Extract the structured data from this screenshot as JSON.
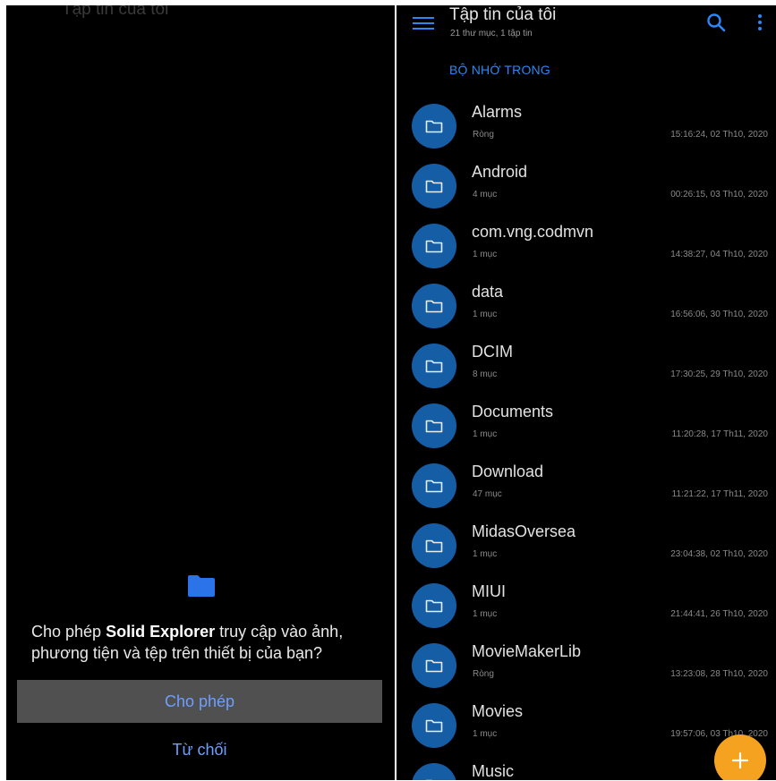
{
  "left_panel": {
    "faded_title": "Tập tin của tôi",
    "permission_prefix": "Cho phép ",
    "permission_app": "Solid Explorer",
    "permission_suffix": " truy cập vào ảnh, phương tiện và tệp trên thiết bị của bạn?",
    "allow_label": "Cho phép",
    "deny_label": "Từ chối",
    "icon": "folder-icon"
  },
  "right_panel": {
    "title": "Tập tin của tôi",
    "subtitle": "21 thư mục, 1 tập tin",
    "section": "BỘ NHỚ TRONG",
    "icons": [
      "menu-icon",
      "search-icon",
      "more-vert-icon",
      "folder-icon",
      "plus-icon"
    ],
    "files": [
      {
        "name": "Alarms",
        "meta": "Ròng",
        "date": "15:16:24, 02 Th10, 2020"
      },
      {
        "name": "Android",
        "meta": "4 mục",
        "date": "00:26:15, 03 Th10, 2020"
      },
      {
        "name": "com.vng.codmvn",
        "meta": "1 mục",
        "date": "14:38:27, 04 Th10, 2020"
      },
      {
        "name": "data",
        "meta": "1 mục",
        "date": "16:56:06, 30 Th10, 2020"
      },
      {
        "name": "DCIM",
        "meta": "8 mục",
        "date": "17:30:25, 29 Th10, 2020"
      },
      {
        "name": "Documents",
        "meta": "1 mục",
        "date": "11:20:28, 17 Th11, 2020"
      },
      {
        "name": "Download",
        "meta": "47 mục",
        "date": "11:21:22, 17 Th11, 2020"
      },
      {
        "name": "MidasOversea",
        "meta": "1 mục",
        "date": "23:04:38, 02 Th10, 2020"
      },
      {
        "name": "MIUI",
        "meta": "1 mục",
        "date": "21:44:41, 26 Th10, 2020"
      },
      {
        "name": "MovieMakerLib",
        "meta": "Ròng",
        "date": "13:23:08, 28 Th10, 2020"
      },
      {
        "name": "Movies",
        "meta": "1 mục",
        "date": "19:57:06, 03 Th10, 2020"
      },
      {
        "name": "Music",
        "meta": "",
        "date": ""
      }
    ]
  },
  "colors": {
    "accent_blue": "#2f86f0",
    "folder_circle": "#155ea6",
    "fab": "#f4a21f",
    "allow_button_bg": "#505050",
    "background": "#000000"
  }
}
